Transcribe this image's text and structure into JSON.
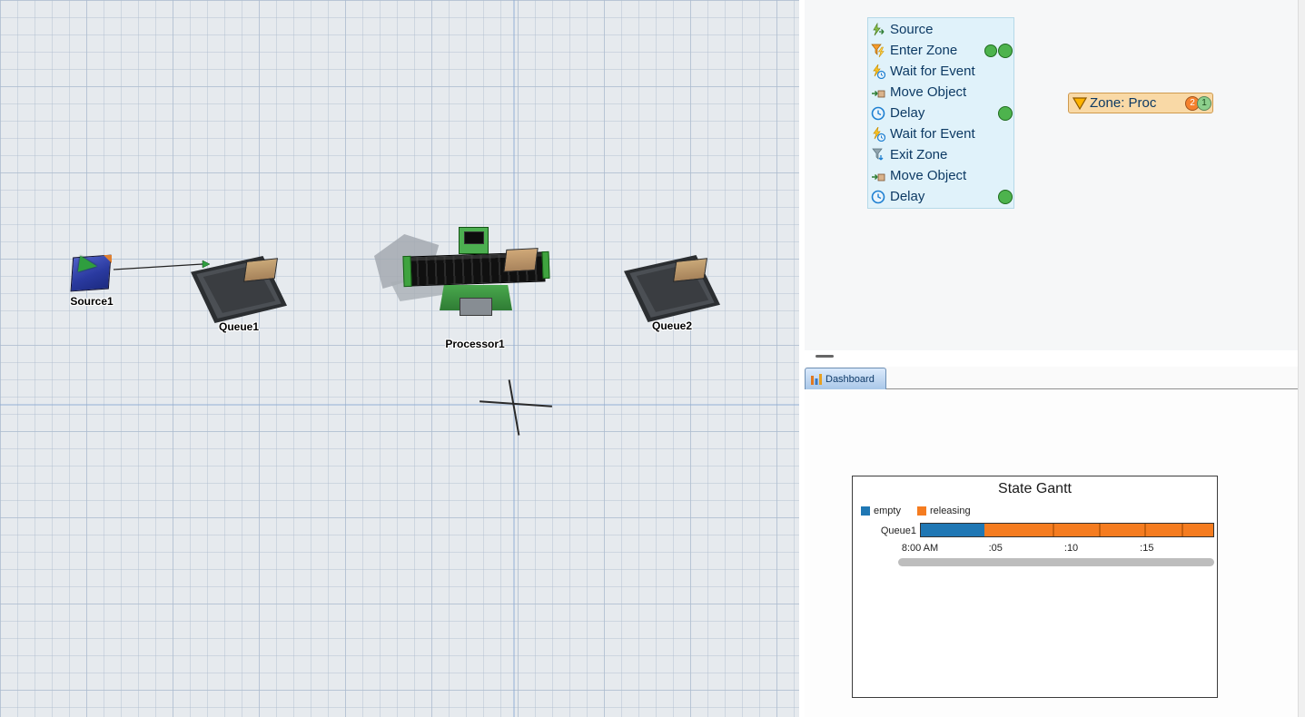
{
  "view3d": {
    "objects": {
      "source": {
        "label": "Source1"
      },
      "queue1": {
        "label": "Queue1"
      },
      "processor": {
        "label": "Processor1"
      },
      "queue2": {
        "label": "Queue2"
      }
    }
  },
  "process_flow": {
    "token_color": "#4db34d",
    "activities": [
      {
        "label": "Source",
        "icon": "source-icon",
        "tokens": 0
      },
      {
        "label": "Enter Zone",
        "icon": "enter-zone-icon",
        "tokens": 2
      },
      {
        "label": "Wait for Event",
        "icon": "wait-for-event-icon",
        "tokens": 0
      },
      {
        "label": "Move Object",
        "icon": "move-object-icon",
        "tokens": 0
      },
      {
        "label": "Delay",
        "icon": "delay-icon",
        "tokens": 1
      },
      {
        "label": "Wait for Event",
        "icon": "wait-for-event-icon",
        "tokens": 0
      },
      {
        "label": "Exit Zone",
        "icon": "exit-zone-icon",
        "tokens": 0
      },
      {
        "label": "Move Object",
        "icon": "move-object-icon",
        "tokens": 0
      },
      {
        "label": "Delay",
        "icon": "delay-icon",
        "tokens": 1
      }
    ],
    "zone_block": {
      "label": "Zone: Proc",
      "badges": [
        {
          "value": "2",
          "color": "#f5812d"
        },
        {
          "value": "1",
          "color": "#8ccf8c"
        }
      ]
    }
  },
  "dashboard": {
    "tab": {
      "label": "Dashboard"
    },
    "gantt": {
      "type": "gantt",
      "title": "State Gantt",
      "legend": [
        {
          "label": "empty",
          "color": "#1f77b4"
        },
        {
          "label": "releasing",
          "color": "#f57c20"
        }
      ],
      "row_label": "Queue1",
      "segments": [
        {
          "state": "empty",
          "color": "#1f77b4",
          "width_pct": 21.7,
          "start_time": "8:00 AM",
          "end_time": "8:04 AM"
        },
        {
          "state": "releasing",
          "color": "#f57c20",
          "width_pct": 78.3,
          "start_time": "8:04 AM",
          "end_time": "8:19 AM"
        }
      ],
      "dividers_pct": [
        45,
        61,
        76.5,
        89
      ],
      "x_ticks": [
        {
          "label": "8:00 AM",
          "pos_pct": 0
        },
        {
          "label": ":05",
          "pos_pct": 25.7
        },
        {
          "label": ":10",
          "pos_pct": 51.4
        },
        {
          "label": ":15",
          "pos_pct": 77.1
        }
      ]
    }
  }
}
